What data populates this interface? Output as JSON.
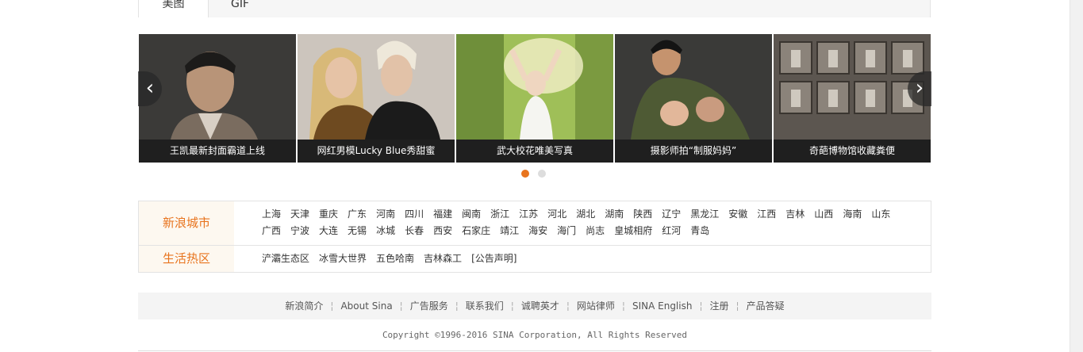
{
  "tabs": [
    {
      "label": "美图",
      "active": true
    },
    {
      "label": "GIF",
      "active": false
    }
  ],
  "slides": [
    {
      "caption": "王凯最新封面霸道上线"
    },
    {
      "caption": "网红男模Lucky Blue秀甜蜜"
    },
    {
      "caption": "武大校花唯美写真"
    },
    {
      "caption": "摄影师拍“制服妈妈”"
    },
    {
      "caption": "奇葩博物馆收藏粪便"
    }
  ],
  "slider": {
    "prev_icon": "‹",
    "next_icon": "›",
    "dots": 2,
    "active_dot": 0
  },
  "city_section": {
    "title": "新浪城市",
    "links": [
      "上海",
      "天津",
      "重庆",
      "广东",
      "河南",
      "四川",
      "福建",
      "闽南",
      "浙江",
      "江苏",
      "河北",
      "湖北",
      "湖南",
      "陕西",
      "辽宁",
      "黑龙江",
      "安徽",
      "江西",
      "吉林",
      "山西",
      "海南",
      "山东",
      "广西",
      "宁波",
      "大连",
      "无锡",
      "冰城",
      "长春",
      "西安",
      "石家庄",
      "靖江",
      "海安",
      "海门",
      "尚志",
      "皇城相府",
      "红河",
      "青岛"
    ]
  },
  "life_section": {
    "title": "生活热区",
    "links": [
      "浐灞生态区",
      "冰雪大世界",
      "五色哈南",
      "吉林森工",
      "[公告声明]"
    ]
  },
  "footer": {
    "links": [
      "新浪简介",
      "About Sina",
      "广告服务",
      "联系我们",
      "诚聘英才",
      "网站律师",
      "SINA English",
      "注册",
      "产品答疑"
    ],
    "separator": "¦",
    "copyright": "Copyright ©1996-2016 SINA Corporation, All Rights Reserved"
  },
  "colors": {
    "accent": "#e8741e",
    "caption_bg": "#1f1f1f"
  }
}
